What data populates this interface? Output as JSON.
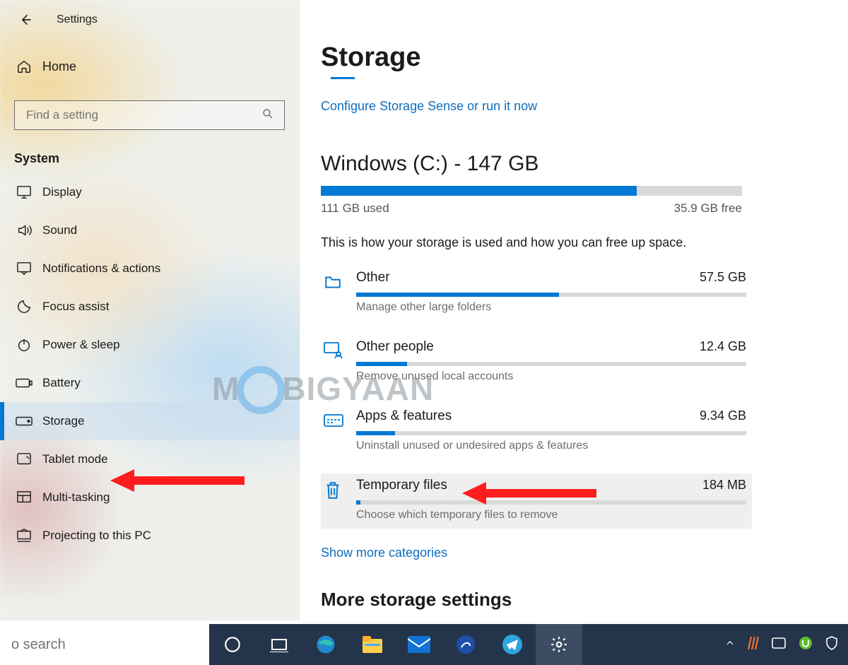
{
  "window": {
    "title": "Settings"
  },
  "sidebar": {
    "home": "Home",
    "search_placeholder": "Find a setting",
    "section": "System",
    "items": [
      {
        "label": "Display",
        "icon": "display-icon"
      },
      {
        "label": "Sound",
        "icon": "sound-icon"
      },
      {
        "label": "Notifications & actions",
        "icon": "notifications-icon"
      },
      {
        "label": "Focus assist",
        "icon": "focus-assist-icon"
      },
      {
        "label": "Power & sleep",
        "icon": "power-icon"
      },
      {
        "label": "Battery",
        "icon": "battery-icon"
      },
      {
        "label": "Storage",
        "icon": "storage-icon",
        "active": true
      },
      {
        "label": "Tablet mode",
        "icon": "tablet-icon"
      },
      {
        "label": "Multi-tasking",
        "icon": "multitask-icon"
      },
      {
        "label": "Projecting to this PC",
        "icon": "projecting-icon"
      }
    ]
  },
  "page": {
    "title": "Storage",
    "config_link": "Configure Storage Sense or run it now",
    "drive_title": "Windows (C:) - 147 GB",
    "used_label": "111 GB used",
    "free_label": "35.9 GB free",
    "used_pct": 75,
    "desc": "This is how your storage is used and how you can free up space.",
    "categories": [
      {
        "name": "Other",
        "size": "57.5 GB",
        "sub": "Manage other large folders",
        "pct": 52,
        "icon": "folder-icon"
      },
      {
        "name": "Other people",
        "size": "12.4 GB",
        "sub": "Remove unused local accounts",
        "pct": 13,
        "icon": "people-icon"
      },
      {
        "name": "Apps & features",
        "size": "9.34 GB",
        "sub": "Uninstall unused or undesired apps & features",
        "pct": 10,
        "icon": "apps-icon"
      },
      {
        "name": "Temporary files",
        "size": "184 MB",
        "sub": "Choose which temporary files to remove",
        "pct": 1,
        "icon": "trash-icon",
        "highlight": true
      }
    ],
    "show_more": "Show more categories",
    "more_settings": "More storage settings"
  },
  "watermark": {
    "left": "M",
    "right": "BIGYAAN"
  },
  "taskbar": {
    "search_placeholder": "o search",
    "tray": [
      "chevron-up-icon",
      "stripes-icon",
      "tablet-tray-icon",
      "utorrent-icon",
      "shield-tray-icon"
    ]
  }
}
